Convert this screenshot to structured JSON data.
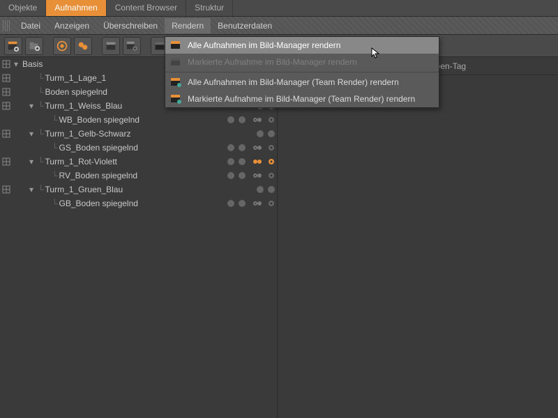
{
  "tabs": {
    "objekte": "Objekte",
    "aufnahmen": "Aufnahmen",
    "content_browser": "Content Browser",
    "struktur": "Struktur"
  },
  "menubar": {
    "datei": "Datei",
    "anzeigen": "Anzeigen",
    "ueberschreiben": "Überschreiben",
    "rendern": "Rendern",
    "benutzerdaten": "Benutzerdaten"
  },
  "dropdown": {
    "item1": "Alle Aufnahmen im Bild-Manager rendern",
    "item2": "Markierte Aufnahme im Bild-Manager rendern",
    "item3": "Alle Aufnahmen im Bild-Manager (Team Render) rendern",
    "item4": "Markierte Aufnahme im Bild-Manager (Team Render) rendern"
  },
  "right_header": "ppen-Tag",
  "tree": {
    "basis": "Basis",
    "items": [
      {
        "label": "Turm_1_Lage_1",
        "indent": 1,
        "toggle": ""
      },
      {
        "label": "Boden spiegelnd",
        "indent": 1,
        "toggle": ""
      },
      {
        "label": "Turm_1_Weiss_Blau",
        "indent": 1,
        "toggle": "▾"
      },
      {
        "label": "WB_Boden spiegelnd",
        "indent": 2,
        "toggle": "",
        "tags": true
      },
      {
        "label": "Turm_1_Gelb-Schwarz",
        "indent": 1,
        "toggle": "▾"
      },
      {
        "label": "GS_Boden spiegelnd",
        "indent": 2,
        "toggle": "",
        "tags": true
      },
      {
        "label": "Turm_1_Rot-Violett",
        "indent": 1,
        "toggle": "▾",
        "orangetags": true
      },
      {
        "label": "RV_Boden spiegelnd",
        "indent": 2,
        "toggle": "",
        "tags": true
      },
      {
        "label": "Turm_1_Gruen_Blau",
        "indent": 1,
        "toggle": "▾"
      },
      {
        "label": "GB_Boden spiegelnd",
        "indent": 2,
        "toggle": "",
        "tags": true
      }
    ]
  }
}
